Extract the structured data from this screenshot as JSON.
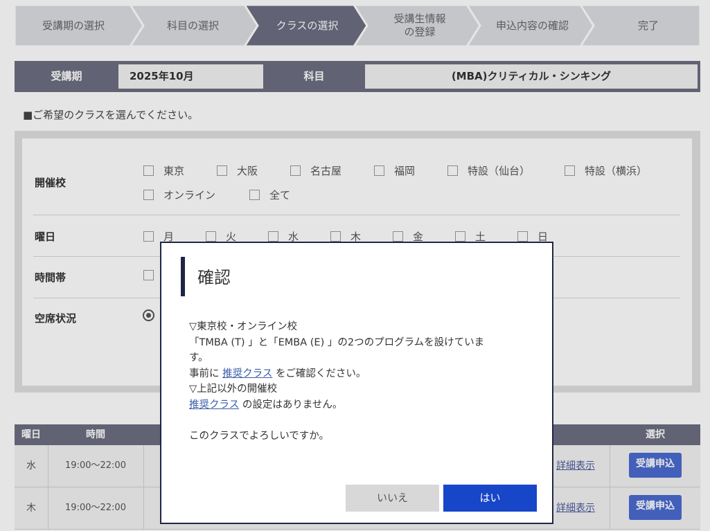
{
  "steps": [
    {
      "label": "受講期の選択",
      "active": false
    },
    {
      "label": "科目の選択",
      "active": false
    },
    {
      "label": "クラスの選択",
      "active": true
    },
    {
      "label": "受講生情報\nの登録",
      "active": false
    },
    {
      "label": "申込内容の確認",
      "active": false
    },
    {
      "label": "完了",
      "active": false
    }
  ],
  "colors": {
    "step_bg": "#dcdde1",
    "step_active": "#6c6e80",
    "header_bg": "#6c6e80",
    "primary_button": "#1846c8",
    "modal_border": "#1f2545"
  },
  "info": {
    "term_label": "受講期",
    "term_value": "2025年10月",
    "subject_label": "科目",
    "subject_value": "(MBA)クリティカル・シンキング"
  },
  "instruction": "■ご希望のクラスを選んでください。",
  "filter": {
    "campus_label": "開催校",
    "campuses": [
      "東京",
      "大阪",
      "名古屋",
      "福岡",
      "特設（仙台）",
      "特設（横浜）",
      "オンライン",
      "全て"
    ],
    "weekday_label": "曜日",
    "weekdays": [
      "月",
      "火",
      "水",
      "木",
      "金",
      "土",
      "日"
    ],
    "time_label": "時間帯",
    "seat_label": "空席状況"
  },
  "table": {
    "headers": {
      "weekday": "曜日",
      "time": "時間",
      "select": "選択"
    },
    "rows": [
      {
        "weekday": "水",
        "time": "19:00〜22:00",
        "detail": "詳細表示",
        "apply": "受講申込"
      },
      {
        "weekday": "木",
        "time": "19:00〜22:00",
        "detail": "詳細表示",
        "apply": "受講申込"
      }
    ]
  },
  "modal": {
    "title": "確認",
    "line1": "▽東京校・オンライン校",
    "line2": "「TMBA (T) 」と「EMBA (E) 」の2つのプログラムを設けていま",
    "line3": "す。",
    "line4_pre": "事前に ",
    "line4_link": "推奨クラス",
    "line4_post": " をご確認ください。",
    "line5": "▽上記以外の開催校",
    "line6_link": "推奨クラス",
    "line6_post": " の設定はありません。",
    "question": "このクラスでよろしいですか。",
    "no_label": "いいえ",
    "yes_label": "はい"
  }
}
